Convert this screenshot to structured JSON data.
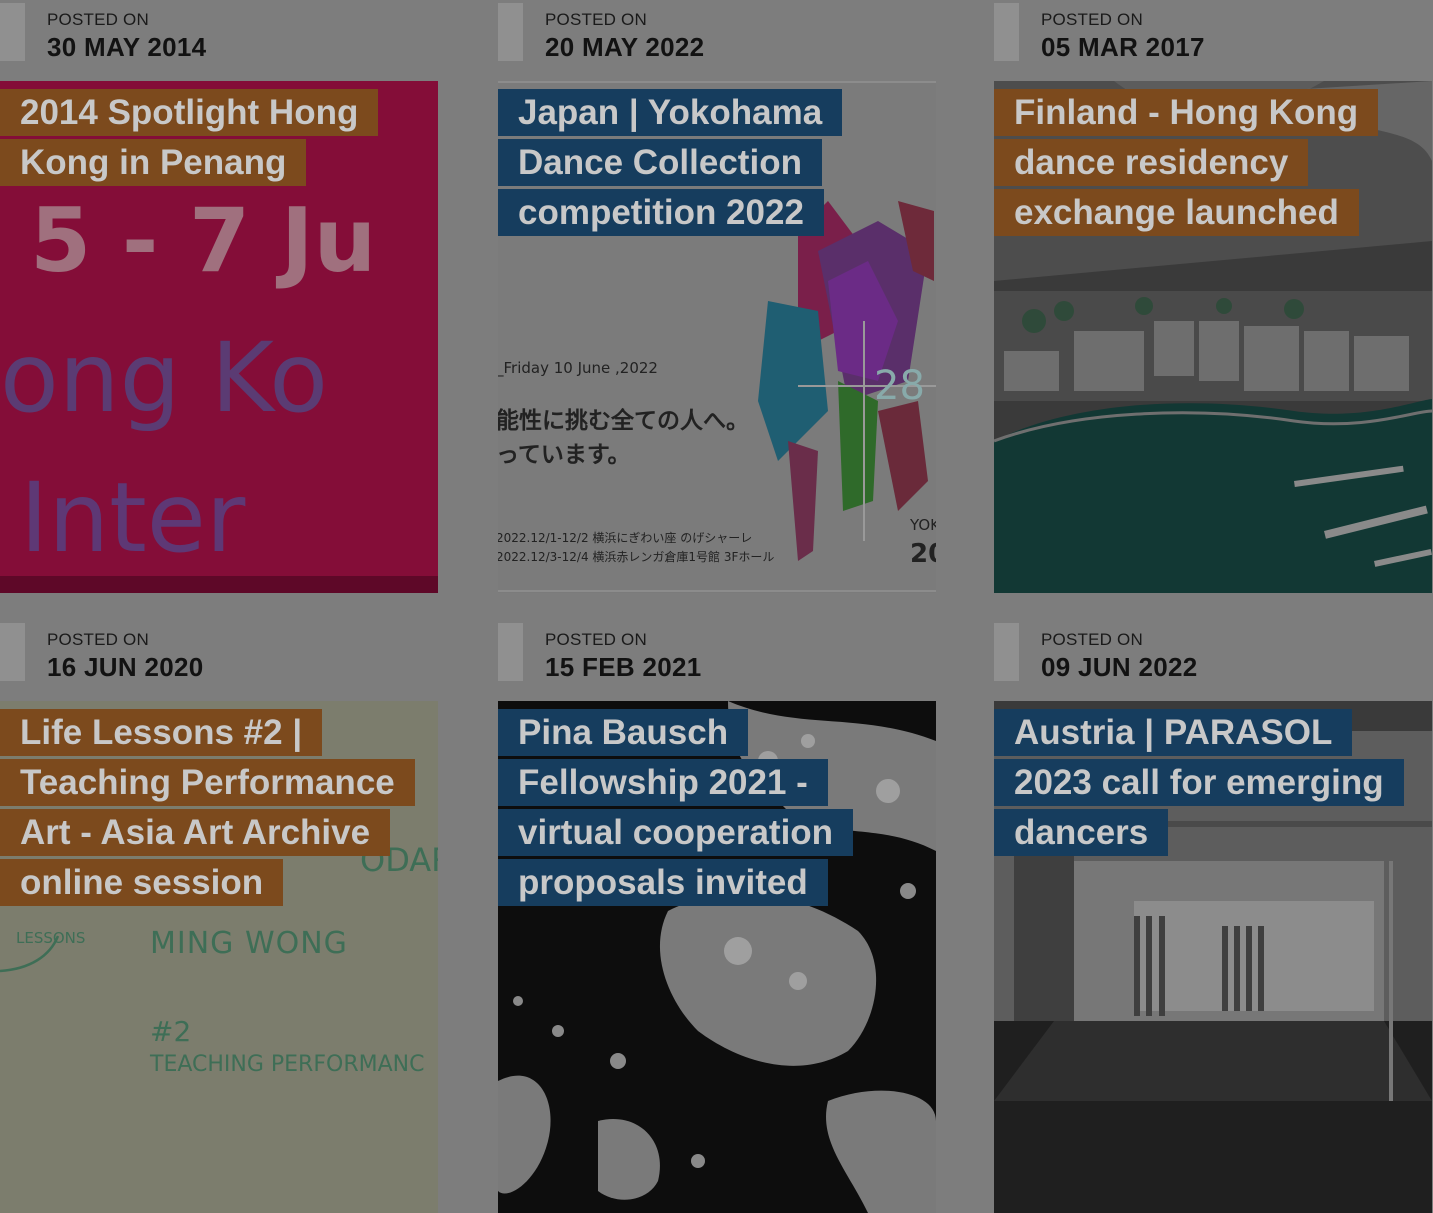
{
  "posts": [
    {
      "posted_label": "POSTED ON",
      "date": "30 MAY 2014",
      "title": "2014 Spotlight Hong Kong in Penang",
      "tag_color": "#7c4a1d",
      "image": {
        "kind": "pink-poster",
        "texts": [
          "5 - 7 Ju",
          "ong Ko",
          "Inter"
        ]
      }
    },
    {
      "posted_label": "POSTED ON",
      "date": "20 MAY 2022",
      "title": "Japan | Yokohama Dance Collection competition 2022",
      "tag_color": "#163d5e",
      "image": {
        "kind": "yokohama-poster",
        "texts": [
          "_Friday 10 June ,2022",
          "能性に挑む全ての人へ。",
          "っています。",
          "2022.12/1-12/2 横浜にぎわい座 のげシャーレ",
          "2022.12/3-12/4 横浜赤レンガ倉庫1号館 3Fホール",
          "28",
          "YOK",
          "20"
        ]
      }
    },
    {
      "posted_label": "POSTED ON",
      "date": "05 MAR 2017",
      "title": "Finland - Hong Kong dance residency exchange launched",
      "tag_color": "#7c4a1d",
      "image": {
        "kind": "aerial-harbour",
        "texts": []
      }
    },
    {
      "posted_label": "POSTED ON",
      "date": "16 JUN 2020",
      "title": "Life Lessons #2 | Teaching Performance Art - Asia Art Archive online session",
      "tag_color": "#7c4a1d",
      "image": {
        "kind": "life-lessons-card",
        "texts": [
          "LESSONS",
          "MING WONG",
          "#2",
          "TEACHING PERFORMANC",
          "ODAR"
        ]
      }
    },
    {
      "posted_label": "POSTED ON",
      "date": "15 FEB 2021",
      "title": "Pina Bausch Fellowship 2021 - virtual cooperation proposals invited",
      "tag_color": "#163d5e",
      "image": {
        "kind": "bw-halftone",
        "texts": []
      }
    },
    {
      "posted_label": "POSTED ON",
      "date": "09 JUN 2022",
      "title": "Austria | PARASOL 2023 call for emerging dancers",
      "tag_color": "#163d5e",
      "image": {
        "kind": "dance-studio",
        "texts": []
      }
    }
  ]
}
